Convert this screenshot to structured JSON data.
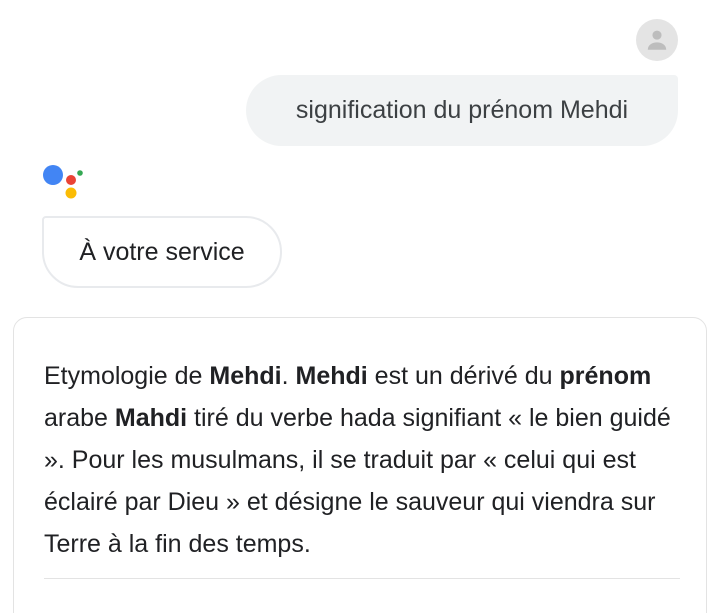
{
  "conversation": {
    "user_query": "signification du prénom Mehdi",
    "assistant_reply": "À votre service"
  },
  "answer_card": {
    "segments": [
      {
        "text": "Etymologie de ",
        "bold": false
      },
      {
        "text": "Mehdi",
        "bold": true
      },
      {
        "text": ". ",
        "bold": false
      },
      {
        "text": "Mehdi",
        "bold": true
      },
      {
        "text": " est un dérivé du ",
        "bold": false
      },
      {
        "text": "prénom",
        "bold": true
      },
      {
        "text": " arabe ",
        "bold": false
      },
      {
        "text": "Mahdi",
        "bold": true
      },
      {
        "text": " tiré du verbe hada signifiant « le bien guidé ». Pour les musulmans, il se traduit par « celui qui est éclairé par Dieu » et désigne le sauveur qui viendra sur Terre à la fin des temps.",
        "bold": false
      }
    ]
  },
  "icons": {
    "avatar": "user-avatar-icon",
    "assistant": "google-assistant-logo-icon"
  },
  "colors": {
    "google_blue": "#4285f4",
    "google_red": "#ea4335",
    "google_yellow": "#fbbc05",
    "google_green": "#34a853",
    "user_bubble_bg": "#f1f3f4"
  }
}
